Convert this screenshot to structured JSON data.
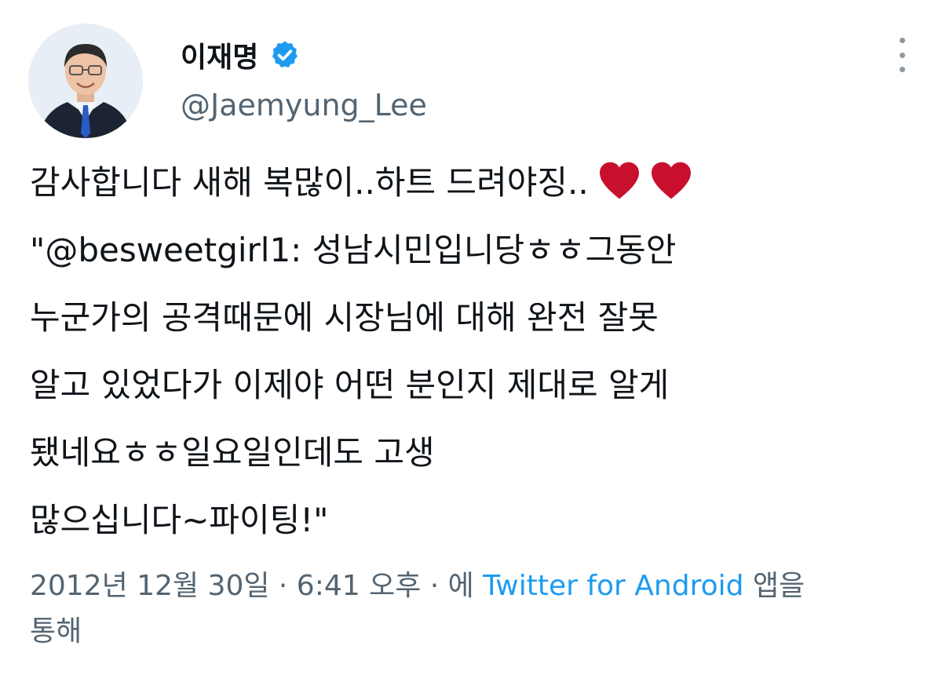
{
  "user": {
    "display_name": "이재명",
    "handle": "@Jaemyung_Lee",
    "verified": true,
    "avatar": "profile-photo",
    "verified_color": "#1d9bf0"
  },
  "menu": {
    "icon": "more-vertical-icon"
  },
  "tweet": {
    "lines": [
      "감사합니다 새해 복많이..하트 드려야징..",
      "\"@besweetgirl1: 성남시민입니당ㅎㅎ그동안",
      "누군가의 공격때문에 시장님에 대해 완전 잘못",
      "알고 있었다가 이제야 어떤 분인지 제대로 알게",
      "됐네요ㅎㅎ일요일인데도 고생",
      "많으십니다~파이팅!\""
    ],
    "emoji": [
      "heart-icon",
      "heart-icon"
    ],
    "heart_color": "#c8102e"
  },
  "meta": {
    "timestamp": "2012년 12월 30일 · 6:41 오후 · 에",
    "source": "Twitter for Android",
    "suffix_1": "앱을",
    "suffix_2": "통해",
    "link_color": "#1d9bf0"
  }
}
